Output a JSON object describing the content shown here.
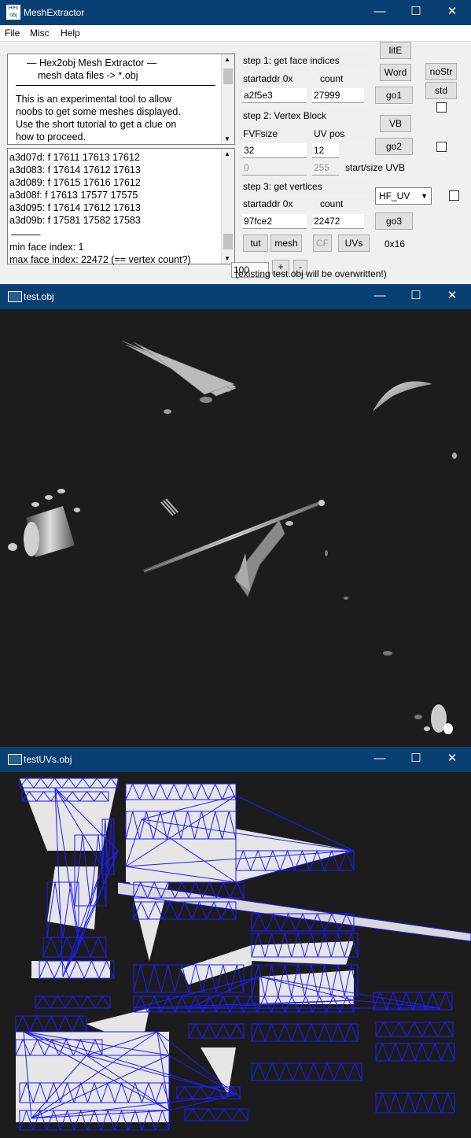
{
  "window1": {
    "title": "MeshExtractor",
    "app_icon_text": "Hex2obj",
    "menu": [
      "File",
      "Misc",
      "Help"
    ],
    "intro_lines": [
      "—   Hex2obj Mesh Extractor   —",
      "mesh data files -> *.obj",
      "This is an experimental tool to allow",
      "noobs to get some meshes displayed.",
      "Use the short tutorial to get a clue on",
      "how to proceed."
    ],
    "log_lines": [
      "a3d07d: f  17611 17613 17612",
      "a3d083: f  17614 17612 17613",
      "a3d089: f  17615 17616 17612",
      "a3d08f: f  17613 17577 17575",
      "a3d095: f  17614 17612 17613",
      "a3d09b: f  17581 17582 17583",
      "———",
      "min face index: 1",
      "max face index: 22472 (== vertex count?)"
    ],
    "step1_label": "step 1: get face indices",
    "startaddr_label": "startaddr 0x",
    "count_label": "count",
    "step1_startaddr": "a2f5e3",
    "step1_count": "27999",
    "step2_label": "step 2: Vertex Block",
    "fvfsize_label": "FVFsize",
    "uvpos_label": "UV pos",
    "fvfsize": "32",
    "uvpos": "12",
    "uvb_start": "0",
    "uvb_size": "255",
    "uvb_label": "start/size UVB",
    "step3_label": "step 3: get vertices",
    "step3_startaddr": "97fce2",
    "step3_count": "22472",
    "buttons": {
      "lite": "litE",
      "word": "Word",
      "go1": "go1",
      "nostr": "noStr",
      "std": "std",
      "vb": "VB",
      "go2": "go2",
      "go3": "go3",
      "tut": "tut",
      "mesh": "mesh",
      "cf": "CF",
      "uvs": "UVs",
      "plus": "+",
      "minus": "-"
    },
    "uv_select": "HF_UV",
    "hex_label": "0x16",
    "scale_value": "100",
    "overwrite_note": "(existing test.obj will be overwritten!)"
  },
  "window2": {
    "title": "test.obj"
  },
  "window3": {
    "title": "testUVs.obj"
  },
  "colors": {
    "titlebar": "#0a3f73",
    "wireframe": "#1c1cff",
    "viewport_bg": "#1c1c1c"
  }
}
